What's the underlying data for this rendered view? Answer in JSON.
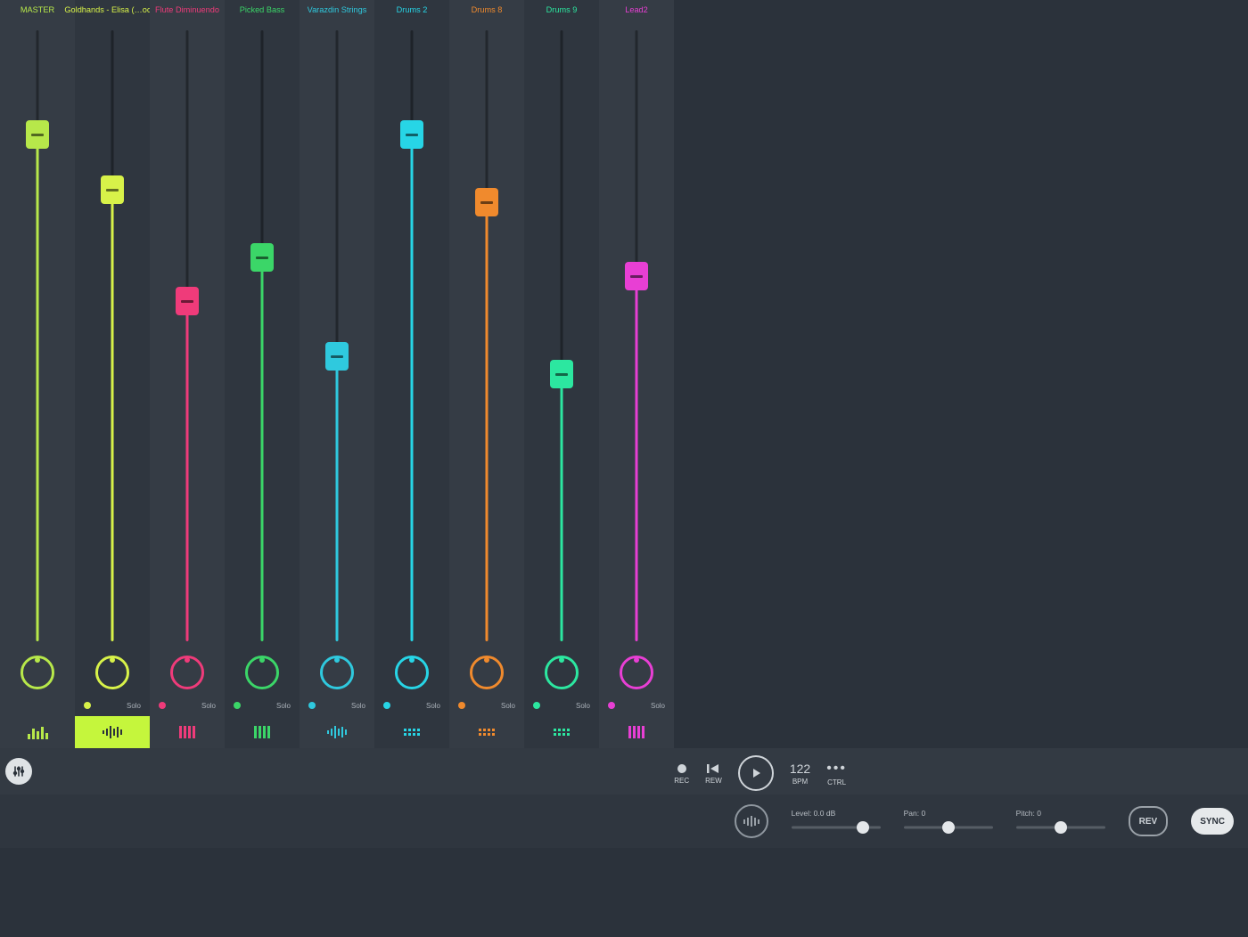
{
  "channels": [
    {
      "name": "MASTER",
      "color": "#b7e84a",
      "faderPct": 83,
      "shade": "a",
      "selected": false,
      "iconType": "bars",
      "hasMuteSolo": false
    },
    {
      "name": "Goldhands - Elisa (…ocal)",
      "color": "#d8f249",
      "faderPct": 74,
      "shade": "b",
      "selected": true,
      "iconType": "wave",
      "iconColor": "#2b323b",
      "hasMuteSolo": true
    },
    {
      "name": "Flute Diminuendo",
      "color": "#ef3b7a",
      "faderPct": 56,
      "shade": "a",
      "selected": false,
      "iconType": "piano",
      "hasMuteSolo": true
    },
    {
      "name": "Picked Bass",
      "color": "#3bd668",
      "faderPct": 63,
      "shade": "b",
      "selected": false,
      "iconType": "piano",
      "hasMuteSolo": true
    },
    {
      "name": "Varazdin Strings",
      "color": "#2fc9de",
      "faderPct": 47,
      "shade": "a",
      "selected": false,
      "iconType": "wave",
      "hasMuteSolo": true
    },
    {
      "name": "Drums 2",
      "color": "#27d5e6",
      "faderPct": 83,
      "shade": "b",
      "selected": false,
      "iconType": "grid",
      "hasMuteSolo": true
    },
    {
      "name": "Drums 8",
      "color": "#f08a2d",
      "faderPct": 72,
      "shade": "a",
      "selected": false,
      "iconType": "grid",
      "hasMuteSolo": true
    },
    {
      "name": "Drums 9",
      "color": "#2ce7a0",
      "faderPct": 44,
      "shade": "b",
      "selected": false,
      "iconType": "grid",
      "hasMuteSolo": true
    },
    {
      "name": "Lead2",
      "color": "#e83fd4",
      "faderPct": 60,
      "shade": "a",
      "selected": false,
      "iconType": "piano",
      "hasMuteSolo": true
    }
  ],
  "soloLabel": "Solo",
  "transport": {
    "rec": {
      "label": "REC"
    },
    "rewind": {
      "label": "REW"
    },
    "bpm": {
      "value": "122",
      "label": "BPM"
    },
    "more": {
      "label": "CTRL"
    }
  },
  "footer": {
    "level": {
      "label": "Level: 0.0 dB",
      "pos": 80
    },
    "pan": {
      "label": "Pan: 0",
      "pos": 50
    },
    "pitch": {
      "label": "Pitch: 0",
      "pos": 50
    },
    "rev": "REV",
    "sync": "SYNC"
  }
}
